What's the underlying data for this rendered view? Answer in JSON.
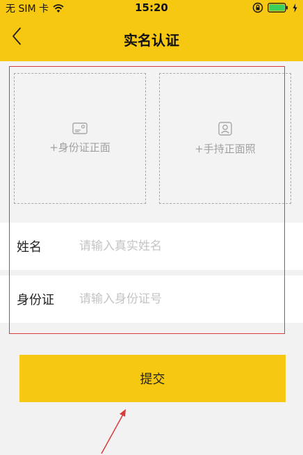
{
  "status_bar": {
    "carrier": "无 SIM 卡",
    "time": "15:20",
    "icons": [
      "wifi-icon",
      "rotation-lock-icon",
      "battery-icon",
      "charging-icon"
    ]
  },
  "nav": {
    "title": "实名认证",
    "back_icon": "chevron-left-icon"
  },
  "uploads": {
    "front": {
      "label": "+身份证正面",
      "icon": "id-card-icon"
    },
    "hold": {
      "label": "+手持正面照",
      "icon": "portrait-icon"
    }
  },
  "form": {
    "name": {
      "label": "姓名",
      "placeholder": "请输入真实姓名",
      "value": ""
    },
    "id_number": {
      "label": "身份证",
      "placeholder": "请输入身份证号",
      "value": ""
    }
  },
  "submit": {
    "label": "提交"
  },
  "colors": {
    "brand": "#f6c812",
    "annotation": "#d83a3a",
    "placeholder": "#c4c4c4"
  }
}
